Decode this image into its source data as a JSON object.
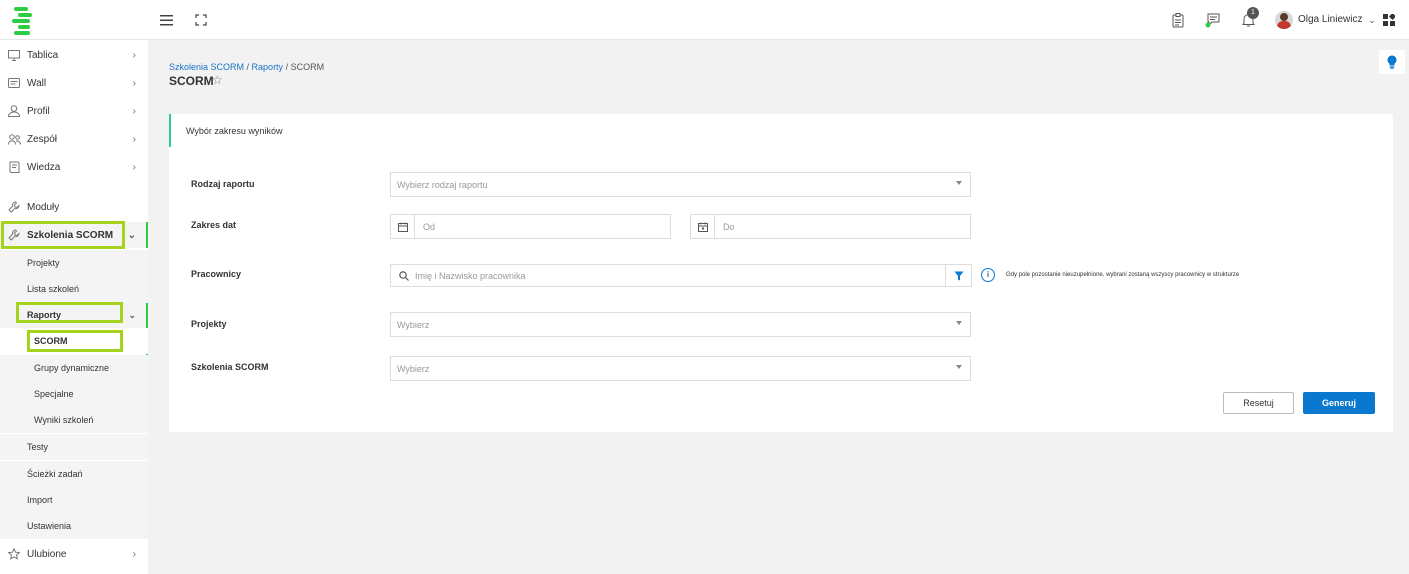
{
  "header": {
    "user_name": "Olga Liniewicz",
    "notification_count": "1"
  },
  "sidebar": {
    "items": [
      {
        "label": "Tablica"
      },
      {
        "label": "Wall"
      },
      {
        "label": "Profil"
      },
      {
        "label": "Zespół"
      },
      {
        "label": "Wiedza"
      },
      {
        "label": "Moduły"
      },
      {
        "label": "Szkolenia SCORM"
      },
      {
        "label": "Ulubione"
      }
    ],
    "scorm_sub": [
      "Projekty",
      "Lista szkoleń",
      "Raporty",
      "Testy",
      "Ścieżki zadań",
      "Import",
      "Ustawienia"
    ],
    "raporty_sub": [
      "SCORM",
      "Grupy dynamiczne",
      "Specjalne",
      "Wyniki szkoleń"
    ]
  },
  "breadcrumb": {
    "part1": "Szkolenia SCORM",
    "sep1": " / ",
    "part2": "Raporty",
    "sep2": " / ",
    "part3": "SCORM"
  },
  "page_title": "SCORM",
  "panel": {
    "title": "Wybór zakresu wyników",
    "report_type_label": "Rodzaj raportu",
    "report_type_placeholder": "Wybierz rodzaj raportu",
    "date_range_label": "Zakres dat",
    "date_from_placeholder": "Od",
    "date_to_placeholder": "Do",
    "employees_label": "Pracownicy",
    "employees_placeholder": "Imię i Nazwisko pracownika",
    "employees_info": "Gdy pole pozostanie nieuzupełnione, wybrani zostaną wszyscy pracownicy w strukturze",
    "projects_label": "Projekty",
    "projects_placeholder": "Wybierz",
    "scorm_label": "Szkolenia SCORM",
    "scorm_placeholder": "Wybierz",
    "reset_button": "Resetuj",
    "generate_button": "Generuj"
  },
  "colors": {
    "accent_blue": "#0b78d0",
    "brand_green": "#2ecc40",
    "highlight_lime": "#a5d31e"
  }
}
